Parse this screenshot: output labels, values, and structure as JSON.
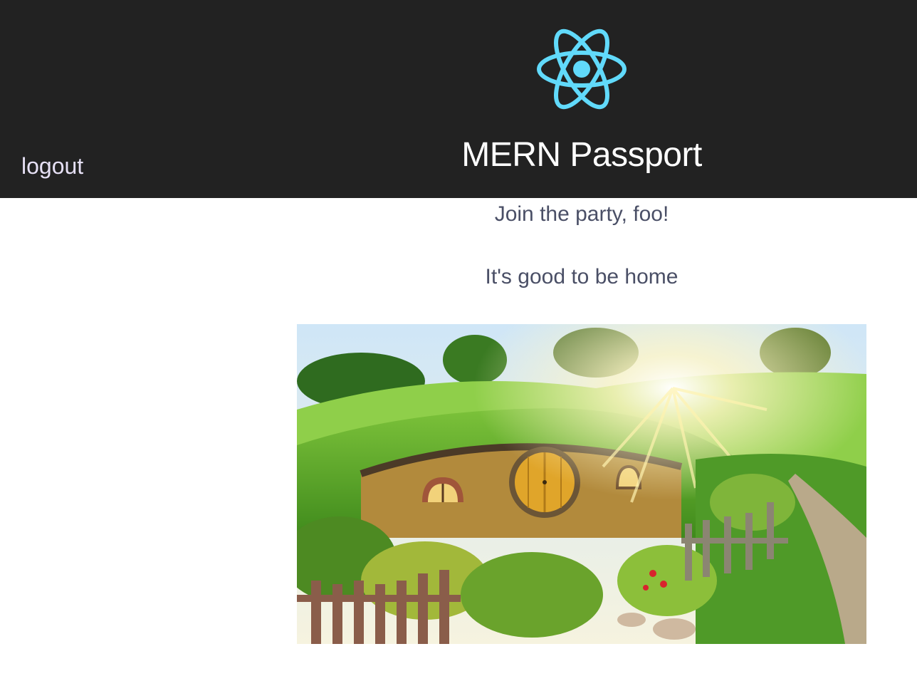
{
  "header": {
    "logout_label": "logout",
    "title": "MERN Passport",
    "logo_icon": "react-atom-icon",
    "logo_color": "#61dafb",
    "background": "#222222"
  },
  "main": {
    "welcome_text": "Join the party, foo!",
    "subtitle_text": "It's good to be home",
    "hero_image_alt": "hobbit-hole-landscape-image"
  }
}
